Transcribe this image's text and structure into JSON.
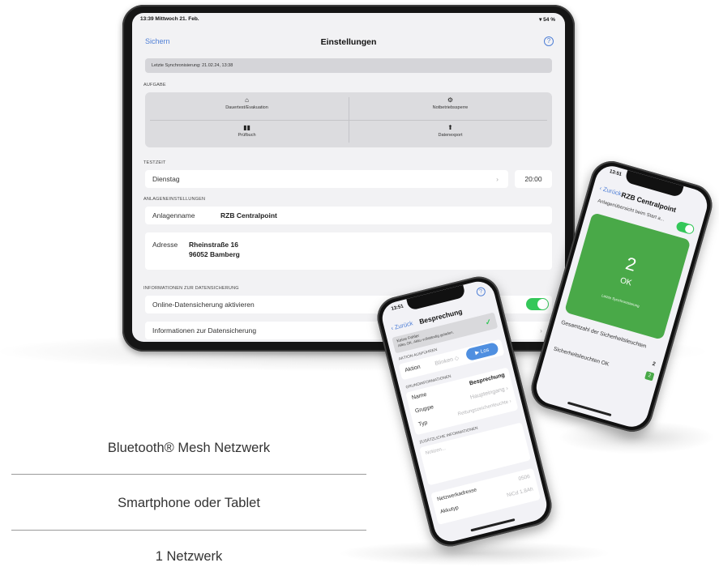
{
  "tablet": {
    "status_time": "13:39  Mittwoch 21. Feb.",
    "status_right": "▾ 54 %",
    "nav_left": "Sichern",
    "nav_title": "Einstellungen",
    "nav_help": "?",
    "sync_text": "Letzte Synchronisierung: 21.02.24, 13:38",
    "section_aufgabe": "AUFGABE",
    "tasks": [
      {
        "icon": "house-icon",
        "glyph": "⌂",
        "label": "Dauertest/Evakuation"
      },
      {
        "icon": "gear-icon",
        "glyph": "⚙",
        "label": "Notbetriebssperre"
      },
      {
        "icon": "book-icon",
        "glyph": "▮▮",
        "label": "Prüfbuch"
      },
      {
        "icon": "export-icon",
        "glyph": "⬆",
        "label": "Datenexport"
      }
    ],
    "section_testzeit": "TESTZEIT",
    "testday": "Dienstag",
    "testday_chevron": "›",
    "testtime": "20:00",
    "section_anlagen": "ANLAGENEINSTELLUNGEN",
    "anlagenname_label": "Anlagenname",
    "anlagenname_value": "RZB Centralpoint",
    "adresse_label": "Adresse",
    "adresse_line1": "Rheinstraße 16",
    "adresse_line2": "96052 Bamberg",
    "section_datensicherung": "INFORMATIONEN ZUR DATENSICHERUNG",
    "online_label": "Online-Datensicherung aktivieren",
    "online_enabled": true,
    "info_label": "Informationen zur Datensicherung",
    "info_chevron": "›"
  },
  "phone_right": {
    "time": "13:51",
    "back": "‹ Zurück",
    "title": "RZB Centralpoint",
    "overview_label": "Anlagenübersicht beim Start a...",
    "overview_enabled": true,
    "count": "2",
    "status": "OK",
    "sub": "Letzte Synchronisierung",
    "total_label": "Gesamtzahl der Sicherheitsleuchten",
    "total_value": "2",
    "ok_label": "Sicherheitsleuchten OK",
    "ok_value": "2"
  },
  "phone_center": {
    "time": "13:51",
    "back": "‹ Zurück",
    "title": "Besprechung",
    "help": "?",
    "banner_line1": "Keine Fehler",
    "banner_line2": "Alles OK, Akku vollständig geladen.",
    "section_aktion": "AKTION AUSFÜHREN",
    "aktion_label": "Aktion",
    "aktion_value": "Blinken ◇",
    "los_label": "▶ Los",
    "section_grund": "GRUNDINFORMATIONEN",
    "name_label": "Name",
    "name_value": "Besprechung",
    "gruppe_label": "Gruppe",
    "gruppe_value": "Haupteingang ›",
    "typ_label": "Typ",
    "typ_value": "Rettungszeichenleuchte ›",
    "section_zusatz": "ZUSÄTZLICHE INFORMATIONEN",
    "notes_placeholder": "Notizen...",
    "netzwerk_label": "Netzwerkadresse",
    "netzwerk_value": "0506",
    "akku_label": "Akkutyp",
    "akku_value": "NiCd 1.8Ah"
  },
  "captions": [
    "Bluetooth® Mesh Netzwerk",
    "Smartphone oder Tablet",
    "1 Netzwerk"
  ],
  "colors": {
    "accent_blue": "#4f7fd6",
    "ok_green": "#49a948",
    "toggle_green": "#34c759"
  }
}
